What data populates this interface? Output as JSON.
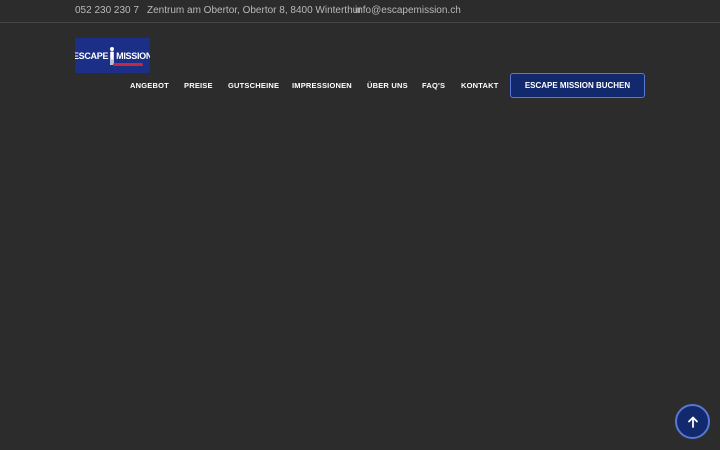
{
  "topbar": {
    "phone": "052 230 230 7",
    "address": "Zentrum am Obertor, Obertor 8, 8400 Winterthur",
    "email": "info@escapemission.ch"
  },
  "logo": {
    "word1": "ESCAPE",
    "word2": "MISSION",
    "brand_color": "#1b2f86",
    "accent_color": "#c8283c"
  },
  "nav": {
    "items": [
      {
        "label": "ANGEBOT"
      },
      {
        "label": "PREISE"
      },
      {
        "label": "GUTSCHEINE"
      },
      {
        "label": "IMPRESSIONEN"
      },
      {
        "label": "ÜBER UNS"
      },
      {
        "label": "FAQ'S"
      },
      {
        "label": "KONTAKT"
      }
    ],
    "cta_label": "ESCAPE MISSION BUCHEN"
  },
  "scroll_top": {
    "icon": "arrow-up-icon"
  },
  "colors": {
    "background": "#2c2c2d",
    "button": "#12296e",
    "button_border": "#5677d6"
  }
}
